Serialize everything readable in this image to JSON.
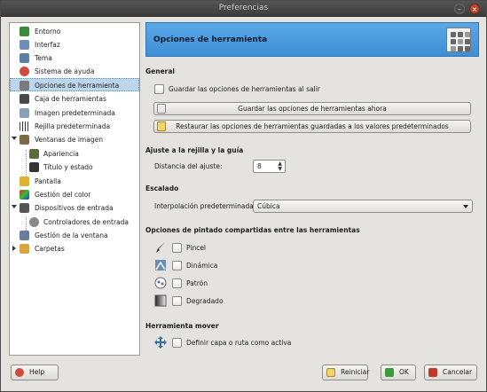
{
  "window": {
    "title": "Preferencias",
    "close_glyph": "×",
    "minimize_glyph": "–"
  },
  "sidebar": {
    "items": [
      {
        "label": "Entorno",
        "icon": "environment-icon",
        "color": "#3b8a3b",
        "level": 0
      },
      {
        "label": "Interfaz",
        "icon": "interface-icon",
        "color": "#6f8fb5",
        "level": 0
      },
      {
        "label": "Tema",
        "icon": "theme-icon",
        "color": "#5c7ea8",
        "level": 0
      },
      {
        "label": "Sistema de ayuda",
        "icon": "help-system-icon",
        "color": "#d14b3c",
        "level": 0
      },
      {
        "label": "Opciones de herramienta",
        "icon": "tool-options-icon",
        "color": "#7a7a7a",
        "level": 0,
        "selected": true
      },
      {
        "label": "Caja de herramientas",
        "icon": "toolbox-icon",
        "color": "#4a4a4a",
        "level": 0
      },
      {
        "label": "Imagen predeterminada",
        "icon": "default-image-icon",
        "color": "#8aa0b8",
        "level": 0
      },
      {
        "label": "Rejilla predeterminada",
        "icon": "default-grid-icon",
        "color": "#3c3c3c",
        "level": 0
      },
      {
        "label": "Ventanas de imagen",
        "icon": "image-windows-icon",
        "color": "#7d6a4a",
        "level": 0,
        "expanded": true
      },
      {
        "label": "Apariencia",
        "icon": "appearance-icon",
        "color": "#5a6e3c",
        "level": 1
      },
      {
        "label": "Título y estado",
        "icon": "title-status-icon",
        "color": "#333333",
        "level": 1
      },
      {
        "label": "Pantalla",
        "icon": "display-icon",
        "color": "#e0b030",
        "level": 0
      },
      {
        "label": "Gestión del color",
        "icon": "color-management-icon",
        "color": "#c040c0",
        "level": 0
      },
      {
        "label": "Dispositivos de entrada",
        "icon": "input-devices-icon",
        "color": "#555555",
        "level": 0,
        "expanded": true
      },
      {
        "label": "Controladores de entrada",
        "icon": "input-controllers-icon",
        "color": "#888888",
        "level": 1
      },
      {
        "label": "Gestión de la ventana",
        "icon": "window-management-icon",
        "color": "#6a7fa0",
        "level": 0
      },
      {
        "label": "Carpetas",
        "icon": "folders-icon",
        "color": "#d9a441",
        "level": 0,
        "collapsed": true
      }
    ]
  },
  "main": {
    "header_title": "Opciones de herramienta",
    "header_icon": "tool-options-large-icon",
    "general": {
      "title": "General",
      "save_on_exit_label": "Guardar las opciones de herramientas al salir",
      "save_now_label": "Guardar las opciones de herramientas ahora",
      "restore_label": "Restaurar las opciones de herramientas guardadas a los valores predeterminados"
    },
    "snap": {
      "title": "Ajuste a la rejilla y la guía",
      "distance_label": "Distancia del ajuste:",
      "distance_value": "8"
    },
    "scaling": {
      "title": "Escalado",
      "interpolation_label": "Interpolación predeterminada:",
      "interpolation_value": "Cúbica"
    },
    "paint_options": {
      "title": "Opciones de pintado compartidas entre las herramientas",
      "items": [
        {
          "label": "Pincel",
          "icon": "brush-icon"
        },
        {
          "label": "Dinámica",
          "icon": "dynamics-icon"
        },
        {
          "label": "Patrón",
          "icon": "pattern-icon"
        },
        {
          "label": "Degradado",
          "icon": "gradient-icon"
        }
      ]
    },
    "move_tool": {
      "title": "Herramienta mover",
      "active_label": "Definir capa o ruta como activa",
      "icon": "move-icon"
    }
  },
  "footer": {
    "help_label": "Help",
    "reset_label": "Reiniciar",
    "ok_label": "OK",
    "cancel_label": "Cancelar"
  },
  "colors": {
    "header_blue": "#4a9ade",
    "selection": "#bcd6ec",
    "window_bg": "#e4e3df"
  }
}
